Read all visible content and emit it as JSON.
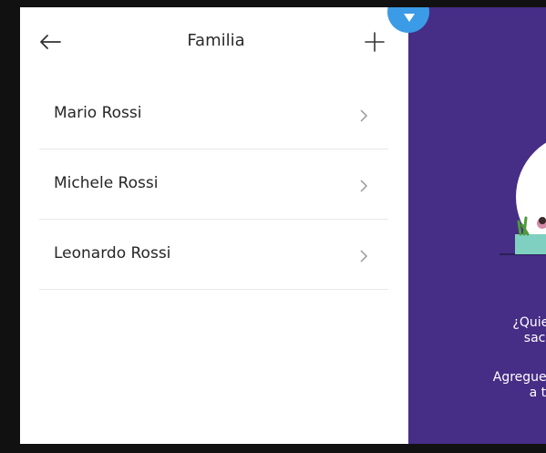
{
  "header": {
    "title": "Familia"
  },
  "family_members": [
    {
      "name": "Mario Rossi"
    },
    {
      "name": "Michele Rossi"
    },
    {
      "name": "Leonardo Rossi"
    }
  ],
  "promo": {
    "line1a": "¿Quier",
    "line1b": "sacri",
    "line2a": "Agregue l",
    "line2b": "a tu"
  },
  "colors": {
    "promo_background": "#462d85",
    "badge": "#3b9be6"
  },
  "icons": {
    "back": "arrow-left-icon",
    "add": "plus-icon",
    "chevron": "chevron-right-icon",
    "badge": "triangle-down-icon"
  }
}
